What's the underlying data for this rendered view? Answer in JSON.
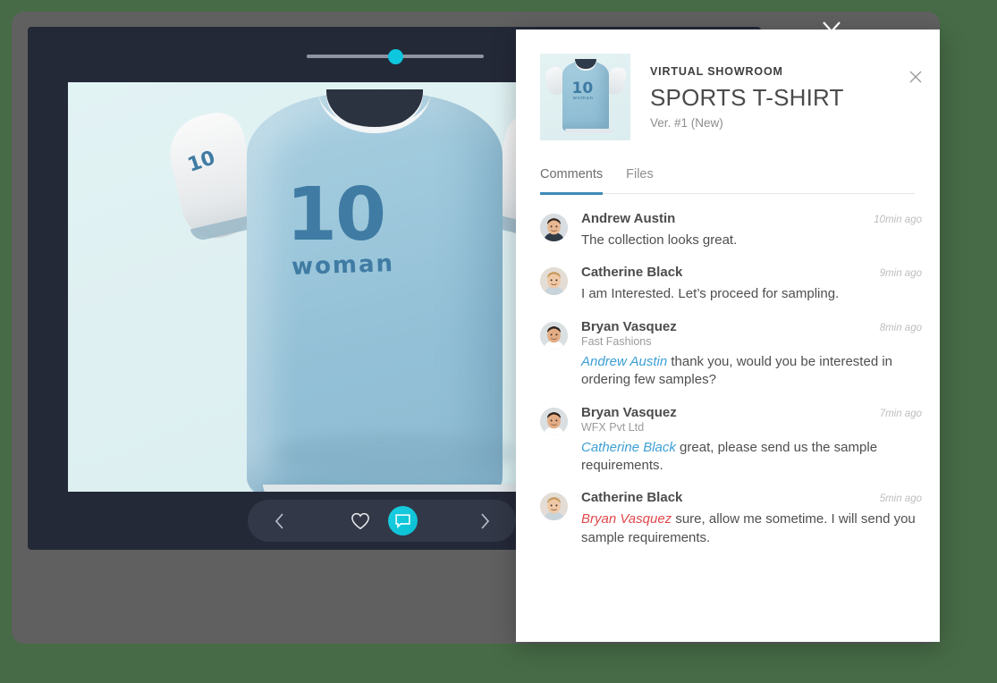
{
  "background": {
    "page_color": "#476b46",
    "card_color": "#606060"
  },
  "viewer": {
    "panel_color": "#242938",
    "slider": {
      "name": "timeline-slider",
      "value": 50,
      "min": 0,
      "max": 100,
      "thumb_color": "#0ec6dd"
    },
    "product_art": {
      "number": "10",
      "word": "woman",
      "sleeve_number": "10",
      "print_color": "#3f7ba3",
      "fabric_color": "#93c0d6"
    },
    "toolbar": {
      "prev_icon": "chevron-left-icon",
      "like_icon": "heart-icon",
      "comment_icon": "comment-bubble-icon",
      "next_icon": "chevron-right-icon",
      "active_color": "#0bbfd4"
    }
  },
  "top_chevron_icon": "chevron-down-icon",
  "panel": {
    "close_icon": "close-icon",
    "header": {
      "eyebrow": "VIRTUAL SHOWROOM",
      "title": "SPORTS T-SHIRT",
      "version": "Ver. #1 (New)",
      "thumbnail_alt": "product-thumbnail"
    },
    "tabs": [
      {
        "label": "Comments",
        "active": true
      },
      {
        "label": "Files",
        "active": false
      }
    ],
    "accent_color": "#3d8ab9",
    "comments": [
      {
        "author": "Andrew Austin",
        "org": "",
        "time": "10min ago",
        "mention": "",
        "mention_color": "",
        "text": "The collection looks great."
      },
      {
        "author": "Catherine Black",
        "org": "",
        "time": "9min ago",
        "mention": "",
        "mention_color": "",
        "text": "I am Interested. Let’s proceed for sampling."
      },
      {
        "author": "Bryan Vasquez",
        "org": "Fast Fashions",
        "time": "8min ago",
        "mention": "Andrew Austin",
        "mention_color": "blue",
        "text": " thank you, would you be interested in ordering few samples?"
      },
      {
        "author": "Bryan Vasquez",
        "org": "WFX Pvt Ltd",
        "time": "7min ago",
        "mention": "Catherine Black",
        "mention_color": "blue",
        "text": " great, please send us the sample requirements."
      },
      {
        "author": "Catherine Black",
        "org": "",
        "time": "5min ago",
        "mention": "Bryan Vasquez",
        "mention_color": "red",
        "text": " sure, allow me sometime. I will send you sample requirements."
      }
    ]
  }
}
